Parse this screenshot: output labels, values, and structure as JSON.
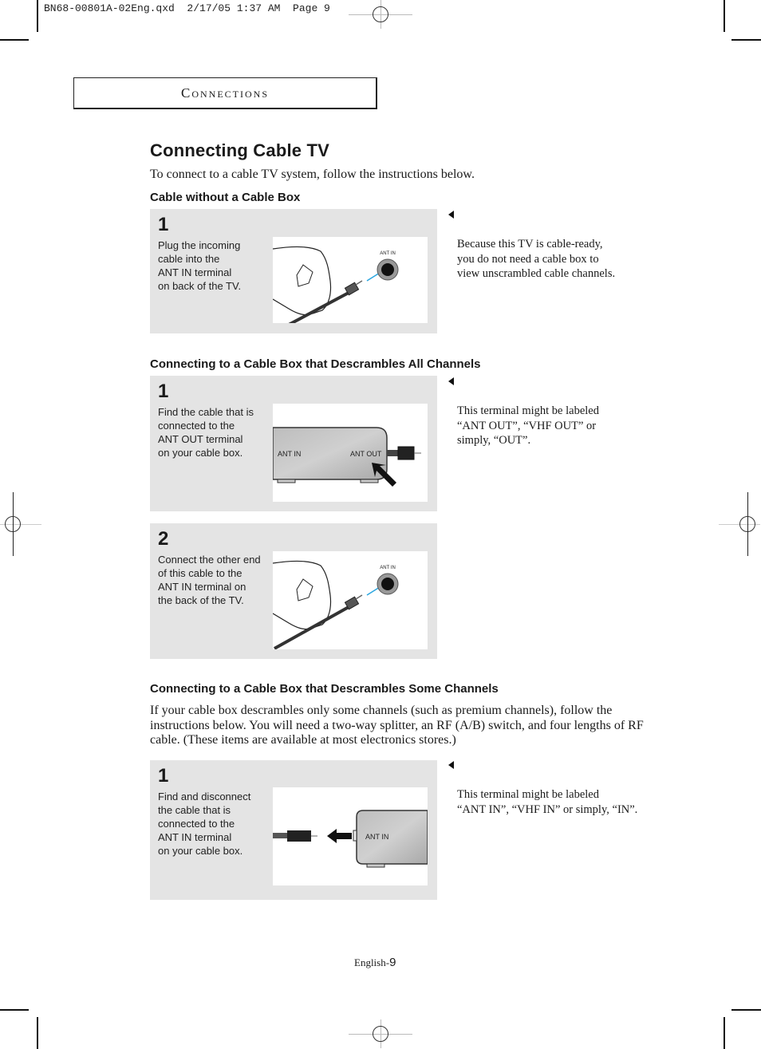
{
  "slug": {
    "text": "BN68-00801A-02Eng.qxd  2/17/05 1:37 AM  Page 9"
  },
  "section": {
    "label": "Connections"
  },
  "page": {
    "title": "Connecting Cable TV",
    "intro": "To connect to a cable TV system, follow the instructions below."
  },
  "sections": [
    {
      "heading": "Cable without a Cable Box",
      "steps": [
        {
          "number": "1",
          "text": "Plug the incoming\ncable into the\nANT IN terminal\non back of the TV.",
          "illustration": {
            "type": "hand-plug",
            "label": "ANT IN"
          }
        }
      ],
      "note": "Because this TV is cable-ready,\nyou do not need a cable box to\nview unscrambled cable channels."
    },
    {
      "heading": "Connecting to a Cable Box that Descrambles All Channels",
      "steps": [
        {
          "number": "1",
          "text": "Find the cable that is\nconnected to the\nANT OUT terminal\non your cable box.",
          "illustration": {
            "type": "cable-box-out",
            "label_left": "ANT IN",
            "label_right": "ANT OUT"
          }
        },
        {
          "number": "2",
          "text": "Connect the other end\nof this cable to the\nANT IN terminal on\nthe back of the TV.",
          "illustration": {
            "type": "hand-plug",
            "label": "ANT IN"
          }
        }
      ],
      "note": "This terminal might be labeled\n“ANT OUT”, “VHF OUT” or\nsimply, “OUT”."
    },
    {
      "heading": "Connecting to a Cable Box that Descrambles Some Channels",
      "paragraph": "If your cable box descrambles only some channels (such as premium channels), follow the instructions below. You will need a two-way splitter, an RF (A/B) switch, and four lengths of RF cable. (These items are available at most electronics stores.)",
      "steps": [
        {
          "number": "1",
          "text": "Find and disconnect\nthe cable that is\nconnected to the\nANT IN terminal\non your cable box.",
          "illustration": {
            "type": "cable-box-in",
            "label": "ANT IN"
          }
        }
      ],
      "note": "This terminal might be labeled\n“ANT IN”, “VHF IN” or simply, “IN”."
    }
  ],
  "footer": {
    "prefix": "English-",
    "page_number": "9"
  },
  "colors": {
    "step_bg": "#e4e4e4",
    "arrow_accent": "#2aa6e0"
  }
}
